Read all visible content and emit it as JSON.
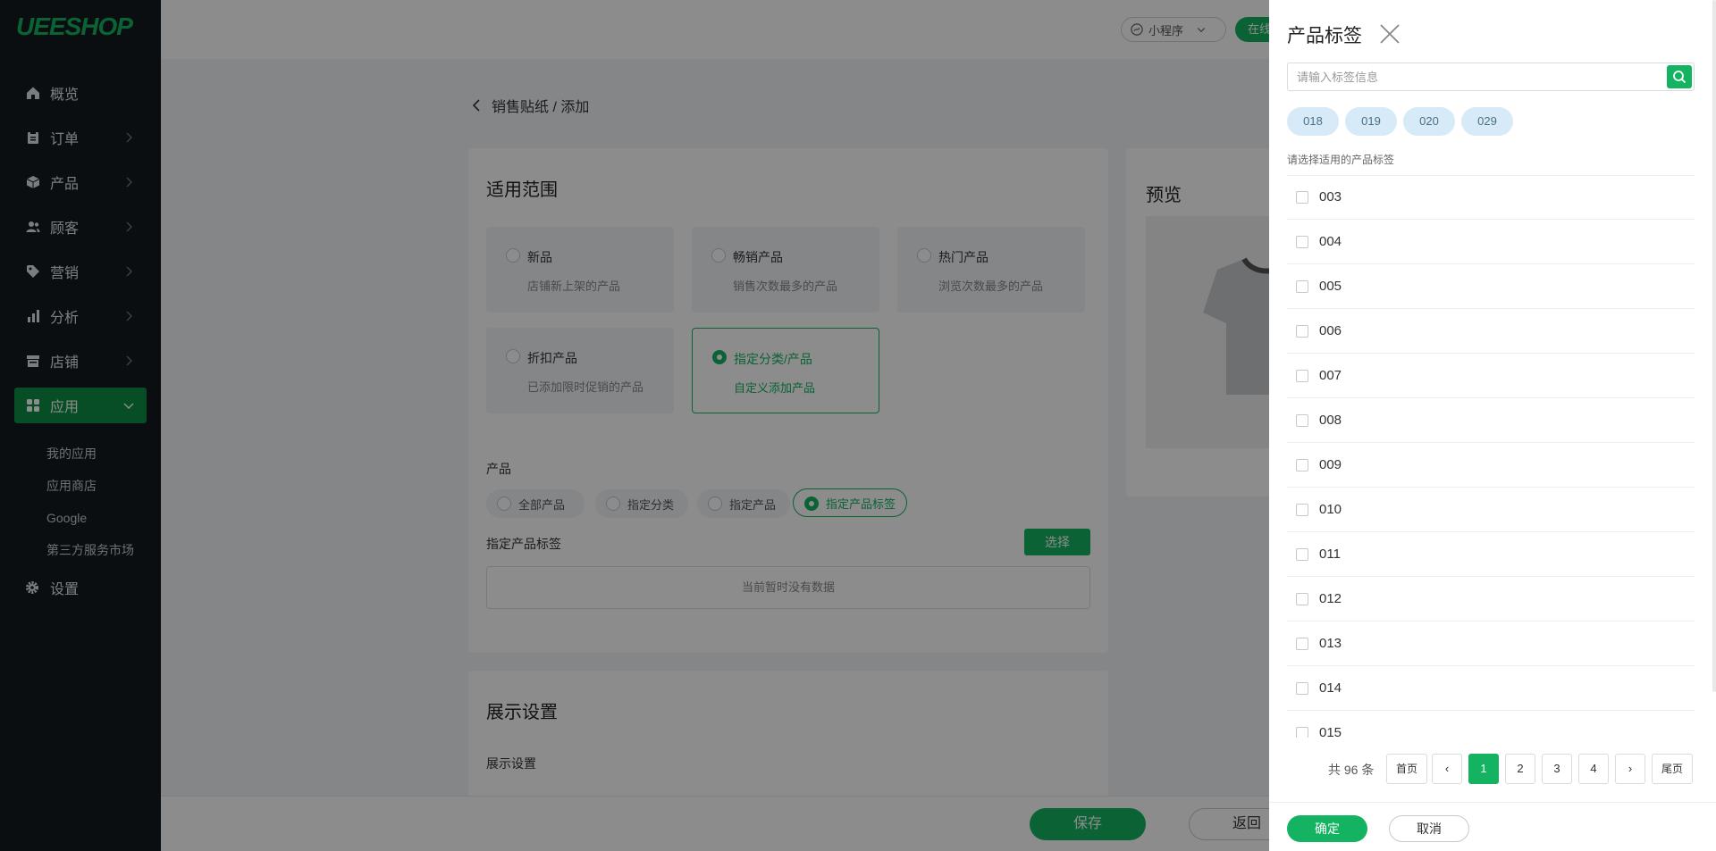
{
  "brand": {
    "logo": "UEESHOP",
    "accent": "#13b362"
  },
  "sidebar": {
    "items": [
      {
        "label": "概览",
        "icon": "home-icon"
      },
      {
        "label": "订单",
        "icon": "clipboard-icon"
      },
      {
        "label": "产品",
        "icon": "box-icon"
      },
      {
        "label": "顾客",
        "icon": "users-icon"
      },
      {
        "label": "营销",
        "icon": "tag-icon"
      },
      {
        "label": "分析",
        "icon": "bar-chart-icon"
      },
      {
        "label": "店铺",
        "icon": "store-icon"
      },
      {
        "label": "应用",
        "icon": "apps-icon"
      }
    ],
    "subitems": [
      "我的应用",
      "应用商店",
      "Google",
      "第三方服务市场"
    ],
    "settings": "设置"
  },
  "topbar": {
    "mini_program": "小程序",
    "online": "在线"
  },
  "breadcrumb": "销售贴纸 / 添加",
  "scope": {
    "title": "适用范围",
    "options": [
      {
        "title": "新品",
        "desc": "店铺新上架的产品"
      },
      {
        "title": "畅销产品",
        "desc": "销售次数最多的产品"
      },
      {
        "title": "热门产品",
        "desc": "浏览次数最多的产品"
      },
      {
        "title": "折扣产品",
        "desc": "已添加限时促销的产品"
      },
      {
        "title": "指定分类/产品",
        "desc": "自定义添加产品"
      }
    ],
    "product_label": "产品",
    "product_pills": [
      "全部产品",
      "指定分类",
      "指定产品",
      "指定产品标签"
    ],
    "tag_label": "指定产品标签",
    "select_button": "选择",
    "empty_text": "当前暂时没有数据"
  },
  "display": {
    "title": "展示设置",
    "sub": "展示设置"
  },
  "preview": {
    "title": "预览"
  },
  "footer": {
    "save": "保存",
    "back": "返回"
  },
  "drawer": {
    "title": "产品标签",
    "search_placeholder": "请输入标签信息",
    "chips": [
      "018",
      "019",
      "020",
      "029"
    ],
    "subtitle": "请选择适用的产品标签",
    "tags": [
      "003",
      "004",
      "005",
      "006",
      "007",
      "008",
      "009",
      "010",
      "011",
      "012",
      "013",
      "014",
      "015"
    ],
    "pagination": {
      "total": "共 96 条",
      "first": "首页",
      "last": "尾页",
      "prev": "‹",
      "next": "›",
      "pages": [
        "1",
        "2",
        "3",
        "4"
      ],
      "current": "1"
    },
    "confirm": "确定",
    "cancel": "取消"
  }
}
